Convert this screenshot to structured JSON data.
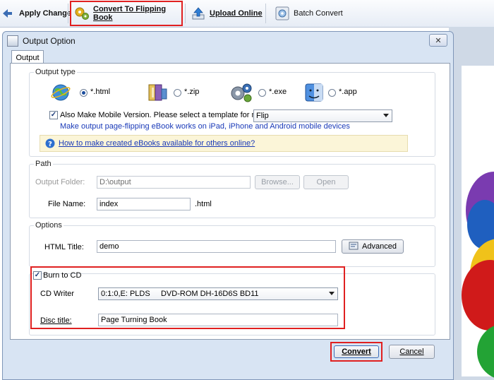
{
  "toolbar": {
    "apply_change": "Apply Change",
    "convert_flipping_book": "Convert To Flipping Book",
    "upload_online": "Upload Online",
    "batch_convert": "Batch Convert"
  },
  "dialog": {
    "title": "Output Option",
    "close_symbol": "✕",
    "tab": "Output"
  },
  "output_type": {
    "label": "Output type",
    "options": [
      {
        "label": "*.html",
        "selected": true,
        "icon": "globe-icon"
      },
      {
        "label": "*.zip",
        "selected": false,
        "icon": "zip-archive-icon"
      },
      {
        "label": "*.exe",
        "selected": false,
        "icon": "exe-gears-icon"
      },
      {
        "label": "*.app",
        "selected": false,
        "icon": "mac-finder-icon"
      }
    ],
    "mobile_check_label": "Also Make Mobile Version. Please select a template for mobile:",
    "mobile_checked": true,
    "mobile_template": "Flip",
    "mobile_note": "Make output page-flipping eBook works on iPad, iPhone and Android mobile devices",
    "help_link": "How to make created eBooks available for others online?"
  },
  "path": {
    "label": "Path",
    "output_folder_label": "Output Folder:",
    "output_folder_value": "D:\\output",
    "browse_label": "Browse...",
    "open_label": "Open",
    "file_name_label": "File Name:",
    "file_name_value": "index",
    "file_ext": ".html"
  },
  "options": {
    "label": "Options",
    "html_title_label": "HTML Title:",
    "html_title_value": "demo",
    "advanced_label": "Advanced"
  },
  "burn": {
    "label": "Burn to CD",
    "checked": true,
    "cd_writer_label": "CD Writer",
    "cd_writer_value": "0:1:0,E: PLDS     DVD-ROM DH-16D6S BD11",
    "disc_title_label": "Disc title:",
    "disc_title_value": "Page Turning Book"
  },
  "footer": {
    "convert_label": "Convert",
    "cancel_label": "Cancel"
  },
  "colors": {
    "highlight": "#e02020",
    "dialog_bg": "#d8e4f3",
    "link": "#1a3ab8"
  }
}
